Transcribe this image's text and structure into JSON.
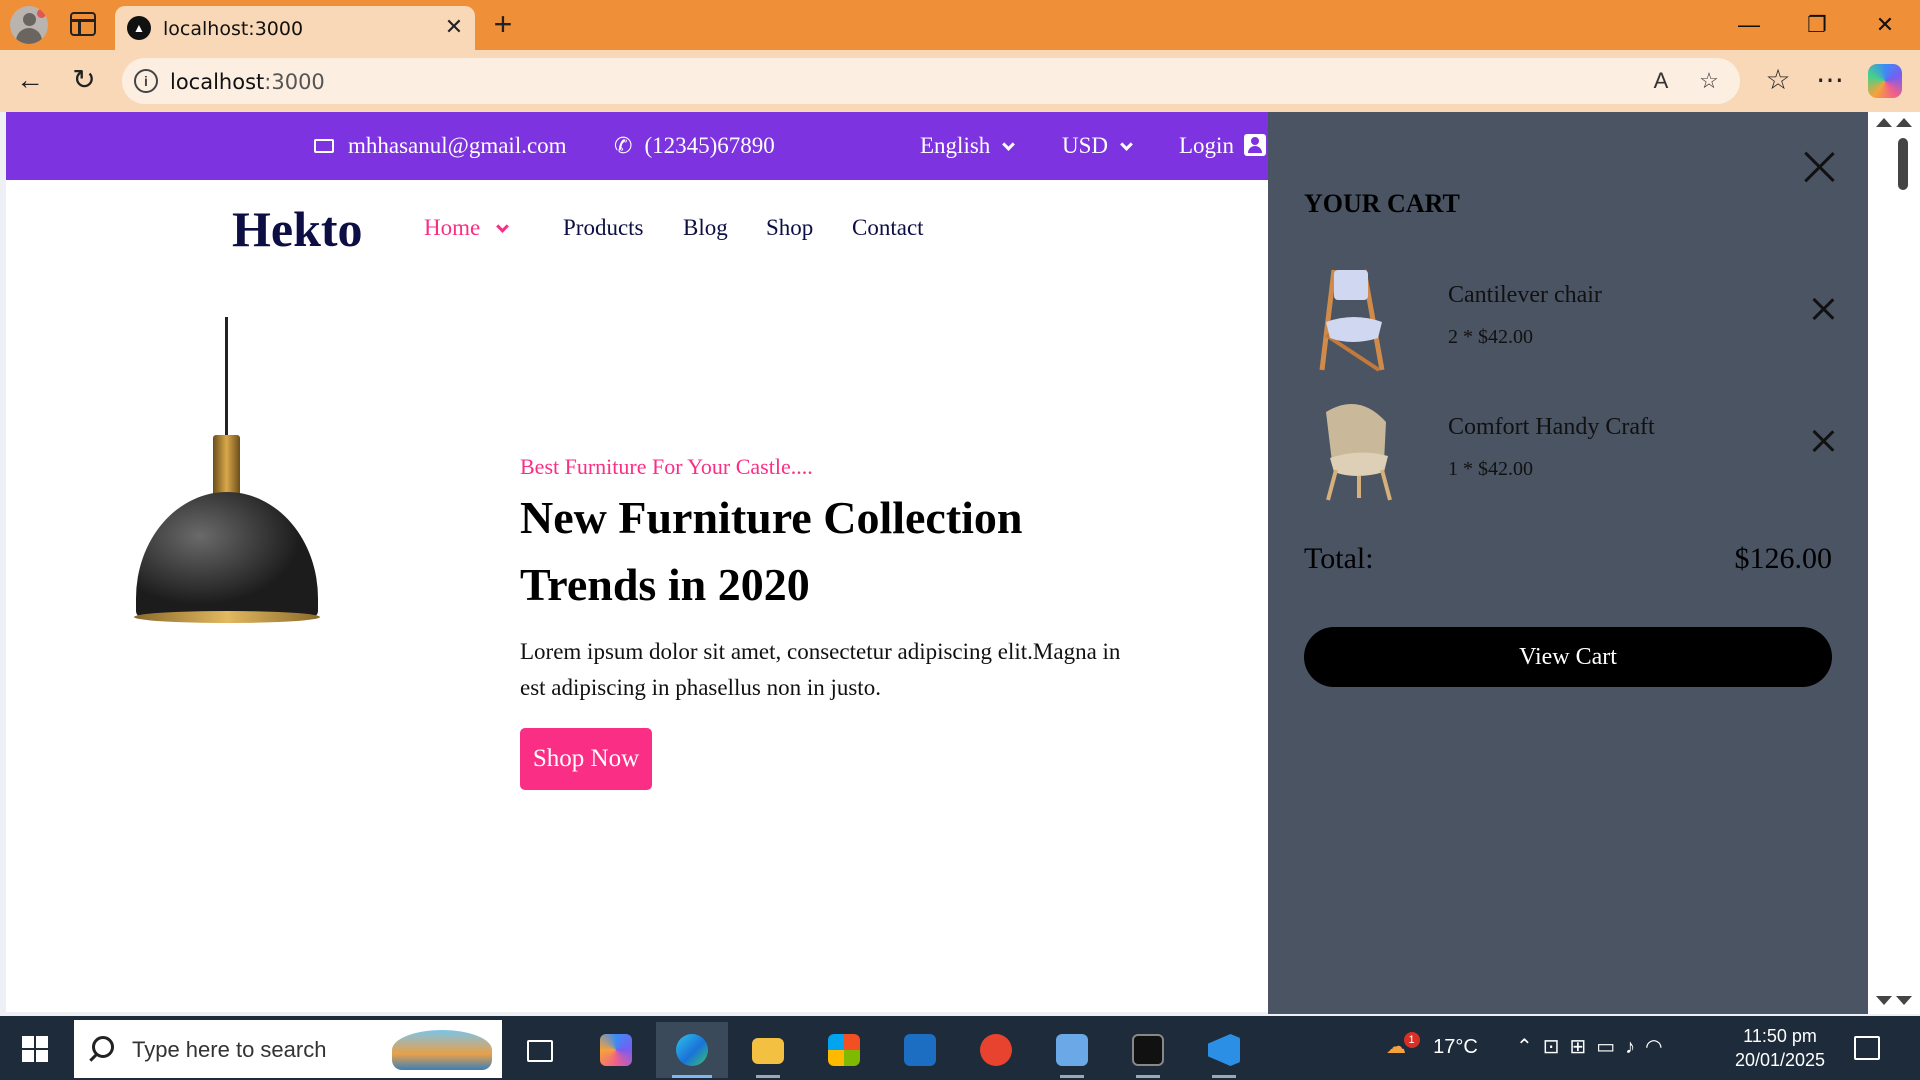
{
  "browser": {
    "tab_title": "localhost:3000",
    "url_host": "localhost",
    "url_port": ":3000",
    "tab_close": "✕",
    "new_tab": "+",
    "window_controls": {
      "minimize": "—",
      "restore": "❐",
      "close": "✕"
    }
  },
  "site": {
    "topbar": {
      "email": "mhhasanul@gmail.com",
      "phone": "(12345)67890",
      "language": "English",
      "currency": "USD",
      "login": "Login"
    },
    "logo": "Hekto",
    "nav": [
      "Home",
      "Products",
      "Blog",
      "Shop",
      "Contact"
    ],
    "hero": {
      "tagline": "Best Furniture For Your Castle....",
      "title": "New Furniture Collection Trends in 2020",
      "text": "Lorem ipsum dolor sit amet, consectetur adipiscing elit.Magna in est adipiscing in phasellus non in justo.",
      "button": "Shop Now"
    }
  },
  "cart": {
    "heading": "YOUR CART",
    "items": [
      {
        "name": "Cantilever chair",
        "qty": "2 * $42.00"
      },
      {
        "name": "Comfort Handy Craft",
        "qty": "1 * $42.00"
      }
    ],
    "total_label": "Total:",
    "total_value": "$126.00",
    "view_cart": "View Cart"
  },
  "taskbar": {
    "search_placeholder": "Type here to search",
    "temperature": "17°C",
    "time": "11:50 pm",
    "date": "20/01/2025",
    "weather_badge": "1"
  },
  "colors": {
    "topbar": "#7e33e0",
    "accent_pink": "#fb2e86",
    "navy": "#0d0e43",
    "cart_bg": "#4a5463",
    "browser_frame": "#ef9039"
  }
}
